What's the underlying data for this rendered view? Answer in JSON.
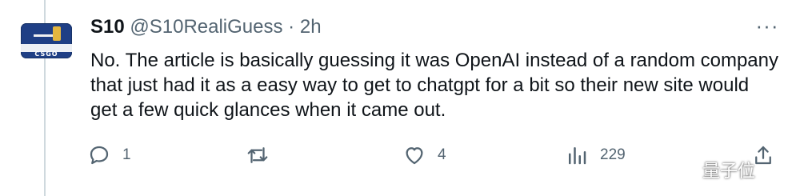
{
  "tweet": {
    "author_name": "S10",
    "handle": "@S10RealiGuess",
    "separator": "·",
    "time": "2h",
    "avatar_label": "CSGO",
    "text": "No. The article is basically guessing it was OpenAI instead of a random company that just had it as a easy way to get to chatgpt for a bit so their new site would get a few quick glances when it came out.",
    "more_menu_icon": "ellipsis-icon"
  },
  "actions": {
    "reply": {
      "icon": "reply-icon",
      "count": "1"
    },
    "retweet": {
      "icon": "retweet-icon",
      "count": ""
    },
    "like": {
      "icon": "heart-icon",
      "count": "4"
    },
    "views": {
      "icon": "analytics-icon",
      "count": "229"
    },
    "share": {
      "icon": "share-icon"
    }
  },
  "watermark": {
    "text": "量子位"
  },
  "colors": {
    "text_primary": "#0f1419",
    "text_secondary": "#536471",
    "thread_line": "#cfd9de",
    "avatar_bg": "#1f3f85"
  }
}
